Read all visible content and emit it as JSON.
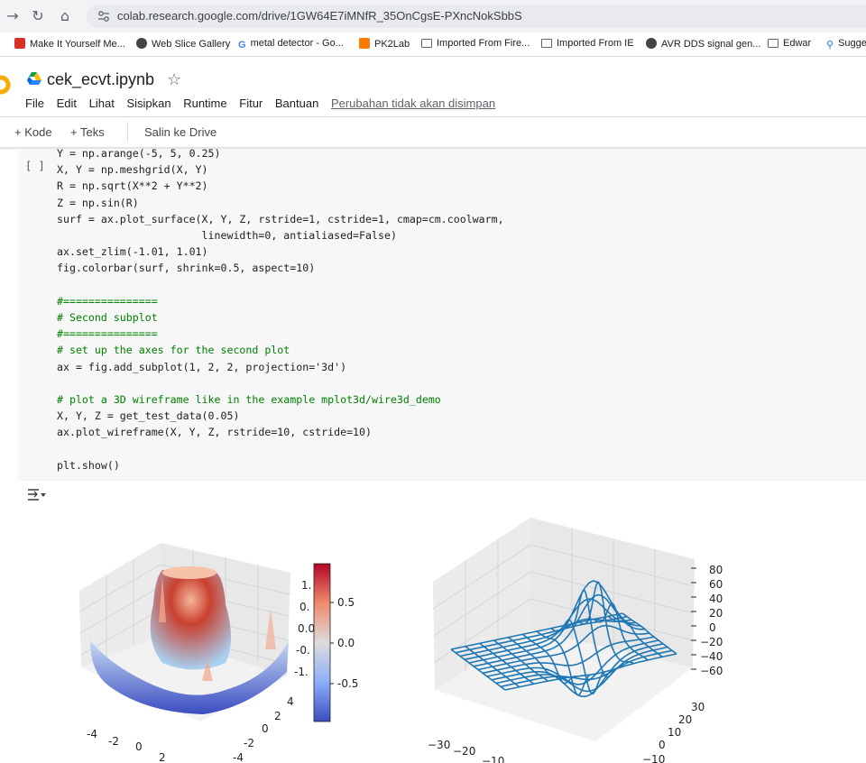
{
  "browser": {
    "url": "colab.research.google.com/drive/1GW64E7iMNfR_35OnCgsE-PXncNokSbbS",
    "bookmarks": [
      {
        "label": "Make It Yourself Me...",
        "icon": "red-book-icon",
        "color": "#d93025"
      },
      {
        "label": "Web Slice Gallery",
        "icon": "globe-icon",
        "color": "#5f6368"
      },
      {
        "label": "metal detector - Go...",
        "icon": "google-g-icon",
        "color": "#4285f4"
      },
      {
        "label": "PK2Lab",
        "icon": "orange-b-icon",
        "color": "#f57c00"
      },
      {
        "label": "Imported From Fire...",
        "icon": "folder-icon",
        "color": "#5f6368"
      },
      {
        "label": "Imported From IE",
        "icon": "folder-icon",
        "color": "#5f6368"
      },
      {
        "label": "AVR DDS signal gen...",
        "icon": "globe-icon",
        "color": "#5f6368"
      },
      {
        "label": "Edwar",
        "icon": "folder-icon",
        "color": "#5f6368"
      },
      {
        "label": "Sugge",
        "icon": "search-icon",
        "color": "#1a73e8"
      }
    ]
  },
  "colab": {
    "title": "cek_ecvt.ipynb",
    "menu": [
      "File",
      "Edit",
      "Lihat",
      "Sisipkan",
      "Runtime",
      "Fitur",
      "Bantuan"
    ],
    "unsaved": "Perubahan tidak akan disimpan",
    "toolbar": {
      "code": "+ Kode",
      "text": "+ Teks",
      "copy": "Salin ke Drive"
    },
    "run_bracket": "[ ]",
    "accent": "#f9ab00"
  },
  "code_lines": [
    "Y = np.arange(-5, 5, 0.25)",
    "X, Y = np.meshgrid(X, Y)",
    "R = np.sqrt(X**2 + Y**2)",
    "Z = np.sin(R)",
    "surf = ax.plot_surface(X, Y, Z, rstride=1, cstride=1, cmap=cm.coolwarm,",
    "                       linewidth=0, antialiased=False)",
    "ax.set_zlim(-1.01, 1.01)",
    "fig.colorbar(surf, shrink=0.5, aspect=10)",
    "",
    "#===============",
    "# Second subplot",
    "#===============",
    "# set up the axes for the second plot",
    "ax = fig.add_subplot(1, 2, 2, projection='3d')",
    "",
    "# plot a 3D wireframe like in the example mplot3d/wire3d_demo",
    "X, Y, Z = get_test_data(0.05)",
    "ax.plot_wireframe(X, Y, Z, rstride=10, cstride=10)",
    "",
    "plt.show()"
  ],
  "figure": {
    "left": {
      "z_ticks": [
        "1.",
        "0.",
        "0.0",
        "-0.",
        "-1."
      ],
      "x_ticks": [
        "-4",
        "-2",
        "0",
        "2"
      ],
      "y_ticks": [
        "4",
        "2",
        "0",
        "-2",
        "-4"
      ]
    },
    "colorbar": {
      "ticks": [
        "0.5",
        "0.0",
        "-0.5"
      ],
      "colors": [
        "#b40426",
        "#f7b89c",
        "#dddcdc",
        "#9abbff",
        "#3b4cc0"
      ]
    },
    "right": {
      "z_ticks": [
        "80",
        "60",
        "40",
        "20",
        "0",
        "−20",
        "−40",
        "−60"
      ],
      "x_ticks": [
        "−30",
        "−20",
        "−10"
      ],
      "y_ticks": [
        "30",
        "20",
        "10",
        "0",
        "−10"
      ],
      "line_color": "#1f77b4"
    }
  }
}
